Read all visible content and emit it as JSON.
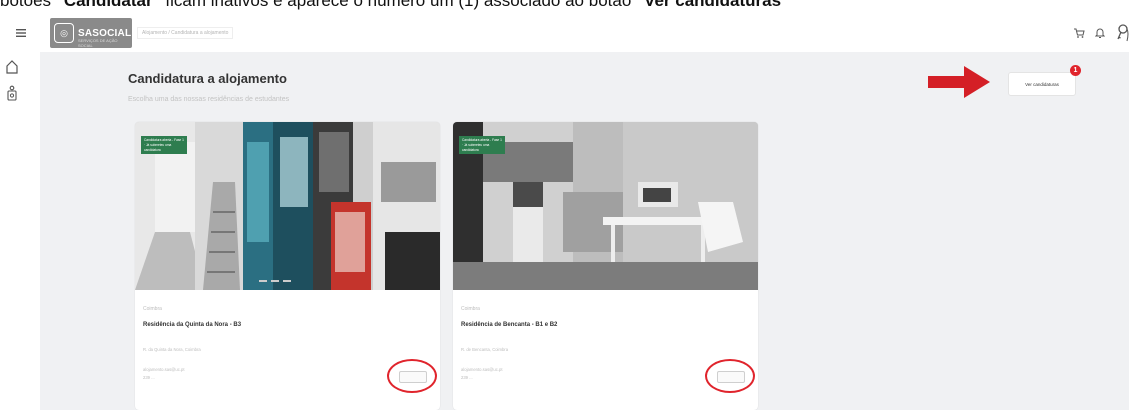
{
  "caption": {
    "text_a": "botões ",
    "bold_a": "\"Candidatar\"",
    "text_b": " ficam inativos e aparece o número um (1) associado ao botão ",
    "bold_b": "\"Ver candidaturas\""
  },
  "header": {
    "logo_text": "SASOCIAL",
    "logo_sub": "SERVIÇOS DE AÇÃO SOCIAL",
    "breadcrumb": "Alojamento / Candidatura a alojamento"
  },
  "page": {
    "title": "Candidatura a alojamento",
    "subtitle": "Escolha uma das nossas residências de estudantes"
  },
  "ver_candidaturas": {
    "label": "Ver candidaturas",
    "count": "1"
  },
  "cards": [
    {
      "tag": "Candidatura aberta - Fase 1 · Já submeteu uma candidatura",
      "label": "Coimbra",
      "title": "Residência da Quinta da Nora - B3",
      "address": "R. da Quinta da Nora, Coimbra",
      "email": "alojamento.sas@uc.pt",
      "phone": "239 ..."
    },
    {
      "tag": "Candidatura aberta - Fase 1 · Já submeteu uma candidatura",
      "label": "Coimbra",
      "title": "Residência de Bencanta - B1 e B2",
      "address": "R. de Bencanta, Coimbra",
      "email": "alojamento.sas@uc.pt",
      "phone": "239 ..."
    }
  ],
  "colors": {
    "accent_red": "#e0242c",
    "tag_green": "#2e7d4f",
    "logo_gray": "#8a8a8a",
    "background": "#f0f1f3"
  }
}
